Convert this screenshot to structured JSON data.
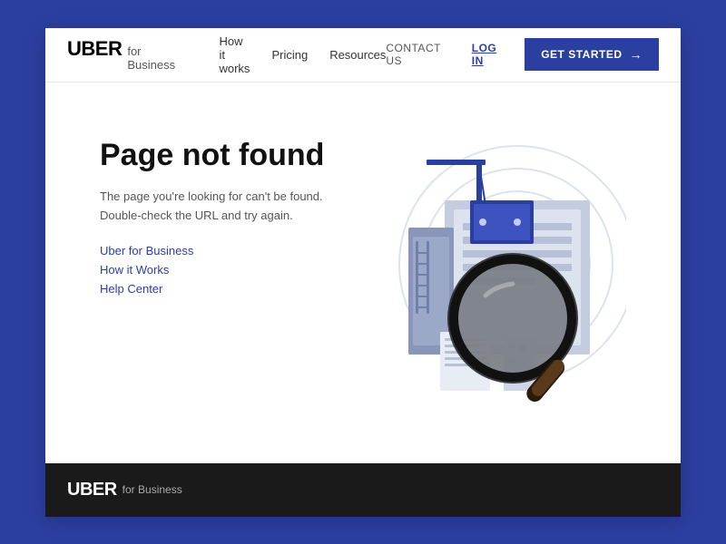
{
  "header": {
    "logo": {
      "uber": "UBER",
      "for_business": "for Business"
    },
    "nav": [
      {
        "label": "How it works",
        "id": "how-it-works"
      },
      {
        "label": "Pricing",
        "id": "pricing"
      },
      {
        "label": "Resources",
        "id": "resources"
      }
    ],
    "contact_us": "CONTACT US",
    "log_in": "LOG IN",
    "get_started": "GET STARTED"
  },
  "main": {
    "title": "Page not found",
    "description": "The page you're looking for can't be found. Double-check the URL and try again.",
    "links": [
      {
        "label": "Uber for Business",
        "href": "#"
      },
      {
        "label": "How it Works",
        "href": "#"
      },
      {
        "label": "Help Center",
        "href": "#"
      }
    ]
  },
  "footer": {
    "uber": "UBER",
    "for_business": "for Business"
  },
  "colors": {
    "brand_blue": "#2a3fa0",
    "dark": "#1a1a1a",
    "text_dark": "#111",
    "text_muted": "#555"
  }
}
